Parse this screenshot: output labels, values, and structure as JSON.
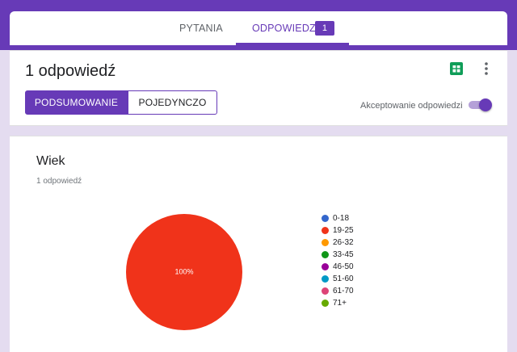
{
  "tabs": {
    "questions_label": "PYTANIA",
    "responses_label": "ODPOWIEDZI",
    "responses_badge": "1"
  },
  "summary": {
    "count_title": "1 odpowiedź",
    "segment_summary": "PODSUMOWANIE",
    "segment_individual": "POJEDYNCZO",
    "accepting_label": "Akceptowanie odpowiedzi",
    "accepting_on": true,
    "icons": [
      "sheets-icon",
      "more-vert-icon"
    ]
  },
  "question": {
    "title": "Wiek",
    "response_count": "1 odpowiedź"
  },
  "colors": {
    "accent": "#673ab7",
    "sheets_green": "#0f9d58"
  },
  "chart_data": {
    "type": "pie",
    "slices": [
      {
        "label": "0-18",
        "value": 0,
        "color": "#3366cc"
      },
      {
        "label": "19-25",
        "value": 100,
        "color": "#f0331a"
      },
      {
        "label": "26-32",
        "value": 0,
        "color": "#ff9900"
      },
      {
        "label": "33-45",
        "value": 0,
        "color": "#109618"
      },
      {
        "label": "46-50",
        "value": 0,
        "color": "#990099"
      },
      {
        "label": "51-60",
        "value": 0,
        "color": "#0099c6"
      },
      {
        "label": "61-70",
        "value": 0,
        "color": "#dd4477"
      },
      {
        "label": "71+",
        "value": 0,
        "color": "#66aa00"
      }
    ],
    "slice_labels": [
      "100%"
    ],
    "legend_position": "right"
  }
}
